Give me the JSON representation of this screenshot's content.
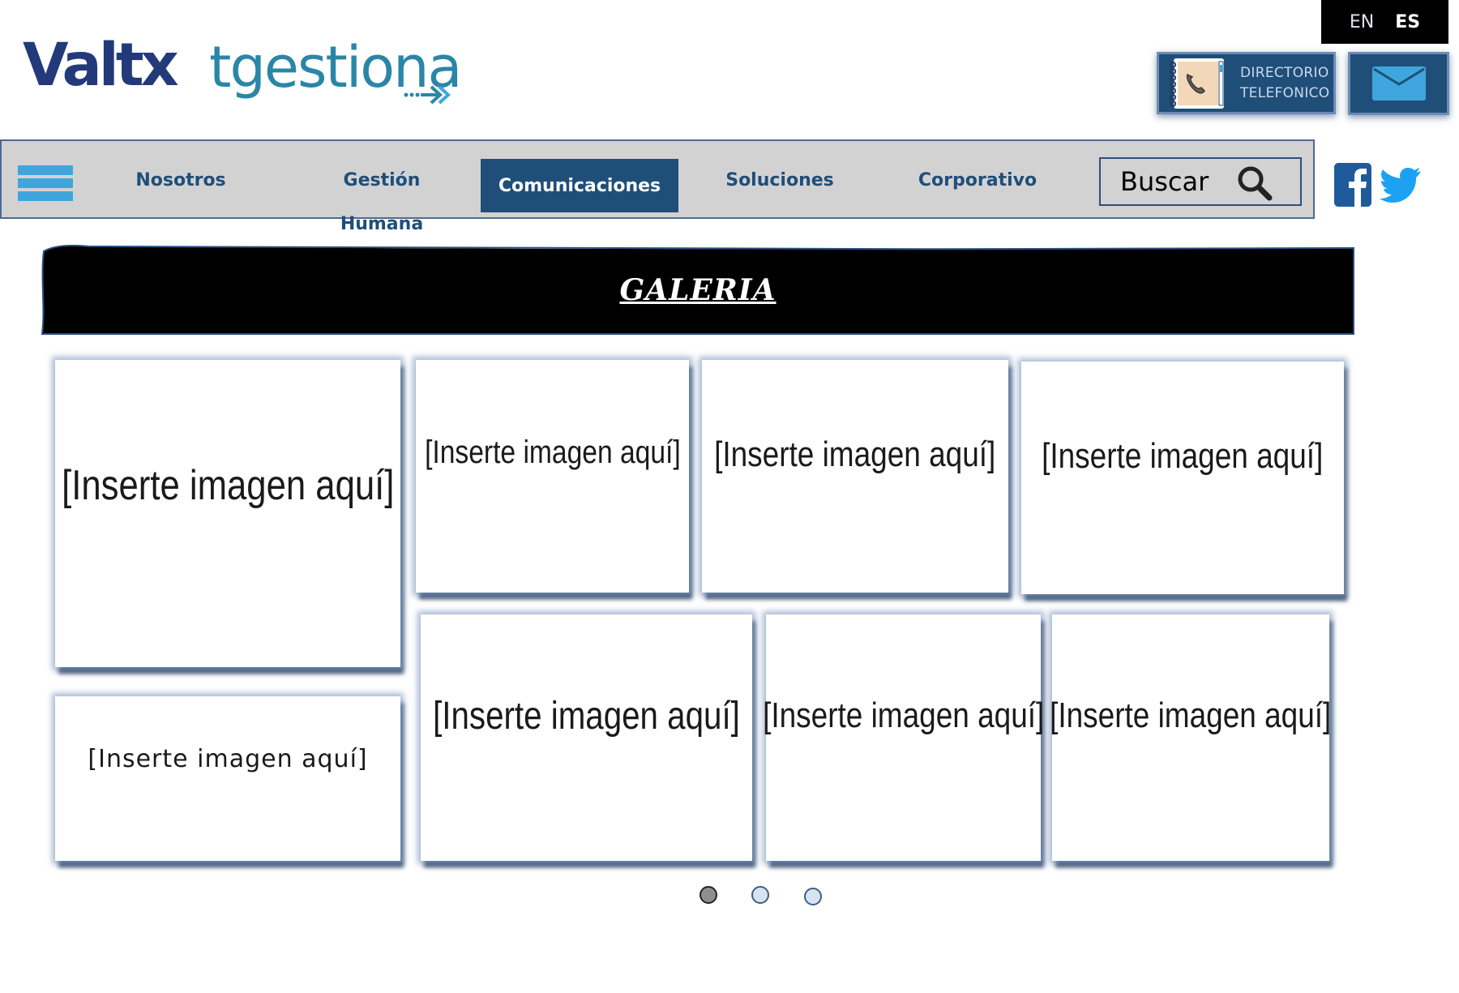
{
  "header": {
    "logo_valtx": "Valtx",
    "logo_tgestiona": "tgestiona",
    "languages": [
      {
        "code": "EN",
        "active": false
      },
      {
        "code": "ES",
        "active": true
      }
    ],
    "directory_line1": "DIRECTORIO",
    "directory_line2": "TELEFONICO",
    "mail_icon": "envelope-icon"
  },
  "nav": {
    "menu_icon": "hamburger-icon",
    "items": [
      {
        "label": "Nosotros",
        "active": false
      },
      {
        "label": "Gestión Humana",
        "active": false
      },
      {
        "label": "Comunicaciones",
        "active": true
      },
      {
        "label": "Soluciones",
        "active": false
      },
      {
        "label": "Corporativo",
        "active": false
      }
    ],
    "search_placeholder": "Buscar",
    "search_icon": "magnifier-icon",
    "social": [
      "facebook-icon",
      "twitter-icon"
    ]
  },
  "gallery": {
    "title": "GALERIA",
    "placeholders": [
      "[Inserte imagen aquí]",
      "[Inserte imagen aquí]",
      "[Inserte imagen aquí]",
      "[Inserte imagen aquí]",
      "[Inserte imagen aquí]",
      "[Inserte imagen aquí]",
      "[Inserte imagen aquí]",
      "[Inserte imagen aquí]"
    ],
    "pager": {
      "pages": 3,
      "current": 1
    }
  },
  "colors": {
    "brand_navy": "#1f4e79",
    "valtx_blue": "#233a7a",
    "tgestiona_teal": "#2a86a7",
    "nav_gray": "#d3d2d3",
    "accent_blue": "#3ea6dd"
  }
}
